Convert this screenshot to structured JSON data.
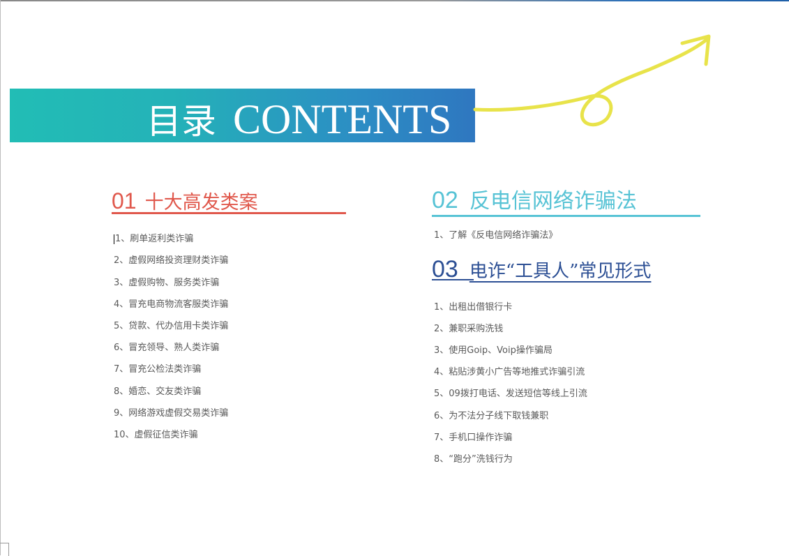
{
  "banner": {
    "title_zh": "目录",
    "title_en": "CONTENTS",
    "accent_start": "#22bdb5",
    "accent_end": "#2f77c0"
  },
  "section01": {
    "number": "01",
    "title": "十大高发类案",
    "color": "#e0584c",
    "items": [
      "1、刷单返利类诈骗",
      "2、虚假网络投资理财类诈骗",
      "3、虚假购物、服务类诈骗",
      "4、冒充电商物流客服类诈骗",
      "5、贷款、代办信用卡类诈骗",
      "6、冒充领导、熟人类诈骗",
      "7、冒充公检法类诈骗",
      "8、婚恋、交友类诈骗",
      "9、网络游戏虚假交易类诈骗",
      "10、虚假征信类诈骗"
    ]
  },
  "section02": {
    "number": "02",
    "title": "反电信网络诈骗法",
    "color": "#57c3d5",
    "items": [
      "1、了解《反电信网络诈骗法》"
    ]
  },
  "section03": {
    "number": "03",
    "title": "电诈“工具人”常见形式",
    "color": "#2c4f94",
    "items": [
      "1、出租出借银行卡",
      "2、兼职采购洗钱",
      "3、使用Goip、Voip操作骗局",
      "4、粘贴涉黄小广告等地推式诈骗引流",
      "5、09拨打电话、发送短信等线上引流",
      "6、为不法分子线下取钱兼职",
      "7、手机口操作诈骗",
      "8、“跑分”洗钱行为"
    ]
  },
  "decoration": {
    "arrow_color": "#e8e34a",
    "arrow_icon": "curly-arrow-icon"
  }
}
